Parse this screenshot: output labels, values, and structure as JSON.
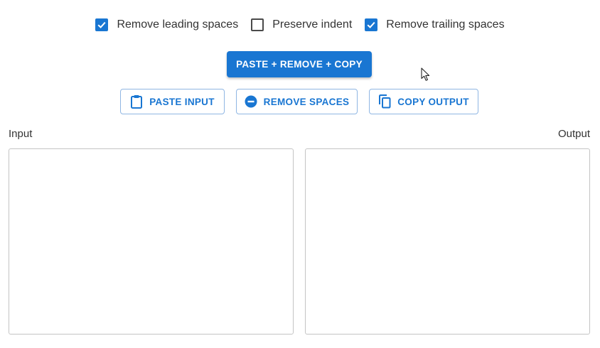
{
  "options": [
    {
      "label": "Remove leading spaces",
      "checked": true
    },
    {
      "label": "Preserve indent",
      "checked": false
    },
    {
      "label": "Remove trailing spaces",
      "checked": true
    }
  ],
  "primary_button": {
    "label": "PASTE + REMOVE + COPY"
  },
  "buttons": {
    "paste": {
      "label": "PASTE INPUT",
      "icon": "clipboard-icon"
    },
    "remove": {
      "label": "REMOVE SPACES",
      "icon": "minus-circle-icon"
    },
    "copy": {
      "label": "COPY OUTPUT",
      "icon": "copy-icon"
    }
  },
  "input": {
    "label": "Input",
    "value": ""
  },
  "output": {
    "label": "Output",
    "value": ""
  },
  "colors": {
    "accent": "#1976d2"
  }
}
